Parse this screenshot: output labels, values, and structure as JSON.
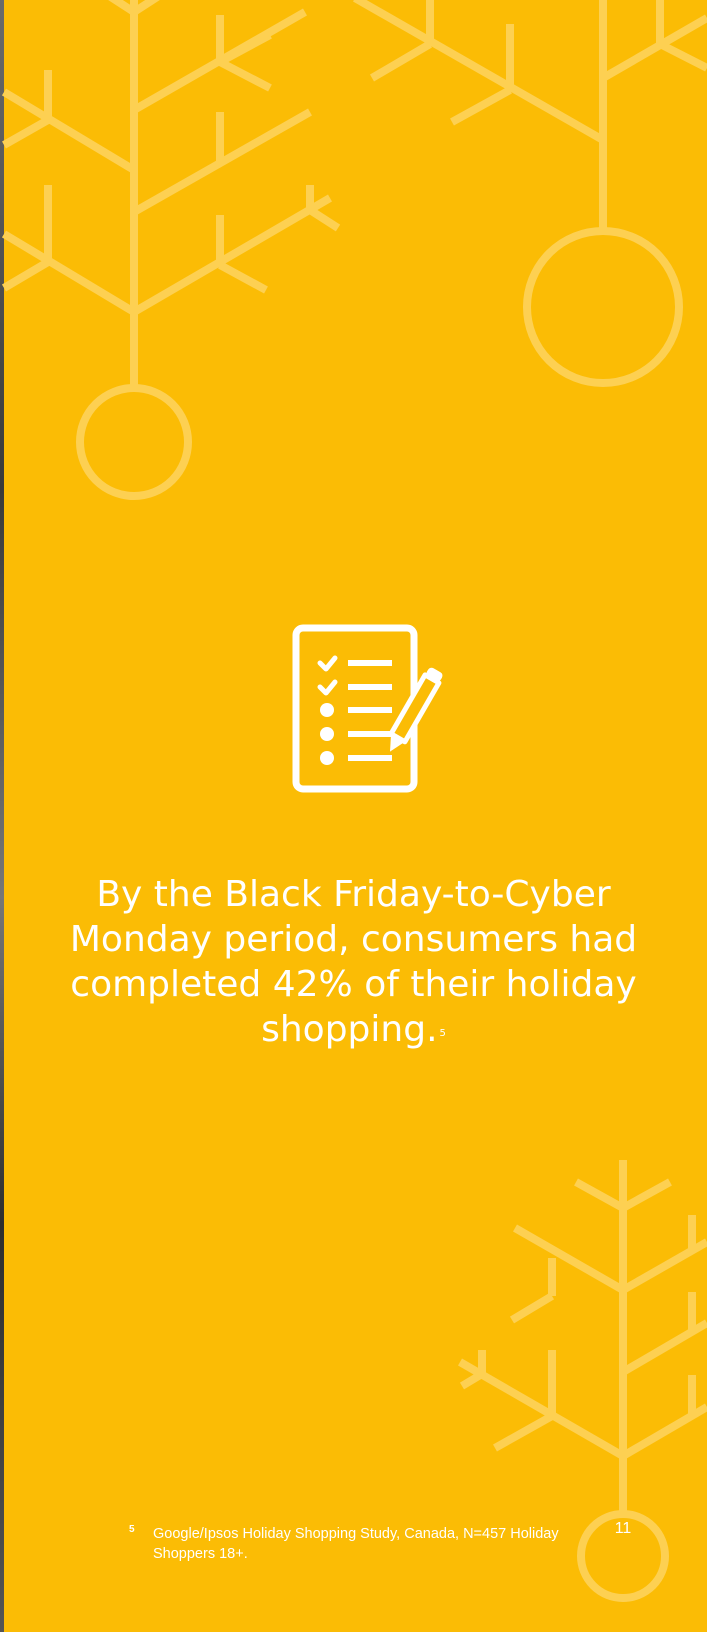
{
  "page": {
    "background_color": "#fbbc05",
    "decoration_color": "#fdd052",
    "text_color": "#ffffff"
  },
  "icon": {
    "name": "checklist-pencil-icon"
  },
  "headline": {
    "text": "By the Black Friday-to-Cyber Monday period, consumers had completed 42% of their holiday shopping.",
    "footnote_ref": "5"
  },
  "footnote": {
    "mark": "5",
    "text": "Google/Ipsos Holiday Shopping Study, Canada, N=457 Holiday Shoppers 18+."
  },
  "page_number": "11"
}
